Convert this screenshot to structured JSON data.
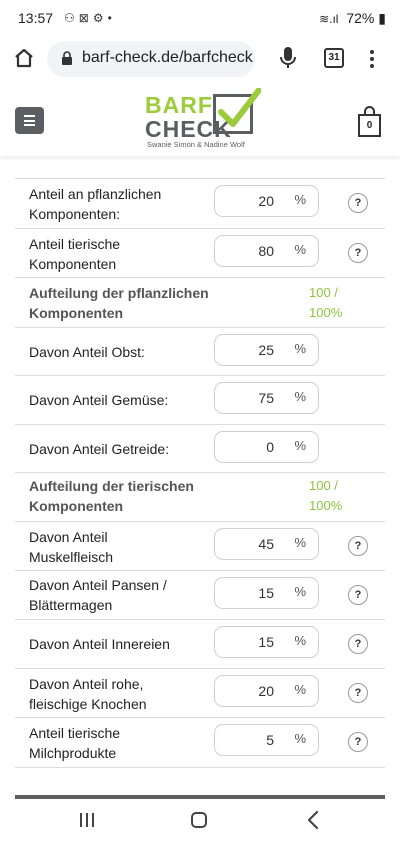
{
  "status_bar": {
    "time": "13:57",
    "battery": "72%"
  },
  "browser": {
    "url": "barf-check.de/barfcheck",
    "tabs_count": "31"
  },
  "site": {
    "logo_line1": "BARF",
    "logo_line2": "CHECK",
    "logo_subtitle": "Swanie Simon & Nadine Wolf",
    "cart_count": "0",
    "colors": {
      "brand_green": "#9ccb3b",
      "brand_gray": "#5a5e61",
      "sum_green": "#8bc53f"
    }
  },
  "form": {
    "unit": "%",
    "help_label": "?",
    "plant_share": {
      "label": "Anteil an pflanzlichen Komponenten:",
      "value": "20"
    },
    "animal_share": {
      "label": "Anteil tierische Komponenten",
      "value": "80"
    },
    "plant_split": {
      "label": "Aufteilung der pflanzlichen Komponenten",
      "sum": "100 / 100%"
    },
    "fruit": {
      "label": "Davon Anteil Obst:",
      "value": "25"
    },
    "vegetables": {
      "label": "Davon Anteil Gemüse:",
      "value": "75"
    },
    "grain": {
      "label": "Davon Anteil Getreide:",
      "value": "0"
    },
    "animal_split": {
      "label": "Aufteilung der tierischen Komponenten",
      "sum": "100 / 100%"
    },
    "muscle_meat": {
      "label": "Davon Anteil Muskelfleisch",
      "value": "45"
    },
    "rumen": {
      "label": "Davon Anteil Pansen / Blättermagen",
      "value": "15"
    },
    "offal": {
      "label": "Davon Anteil Innereien",
      "value": "15"
    },
    "bones": {
      "label": "Davon Anteil rohe, fleischige Knochen",
      "value": "20"
    },
    "dairy": {
      "label": "Anteil tierische Milchprodukte",
      "value": "5"
    }
  }
}
